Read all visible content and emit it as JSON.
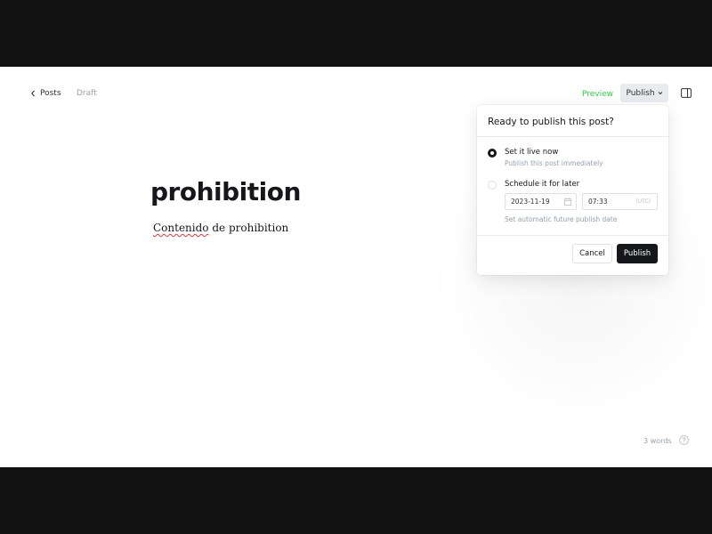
{
  "header": {
    "back_label": "Posts",
    "status": "Draft",
    "preview_label": "Preview",
    "publish_label": "Publish"
  },
  "editor": {
    "title": "prohibition",
    "body_word1": "Contenido",
    "body_rest": " de prohibition"
  },
  "footer": {
    "word_count": "3 words"
  },
  "publish_popover": {
    "heading": "Ready to publish this post?",
    "option_now": {
      "label": "Set it live now",
      "description": "Publish this post immediately",
      "selected": true
    },
    "option_later": {
      "label": "Schedule it for later",
      "selected": false,
      "date_value": "2023-11-19",
      "time_value": "07:33",
      "timezone": "(UTC)",
      "hint": "Set automatic future publish date"
    },
    "cancel_label": "Cancel",
    "confirm_label": "Publish"
  },
  "colors": {
    "accent_green": "#30cf43",
    "primary_dark": "#15171a",
    "muted_text": "#95a0ad"
  },
  "icons": {
    "back": "chevron-left-icon",
    "publish_caret": "chevron-down-icon",
    "sidebar": "sidebar-panel-icon",
    "calendar": "calendar-icon",
    "help": "question-circle-icon"
  }
}
